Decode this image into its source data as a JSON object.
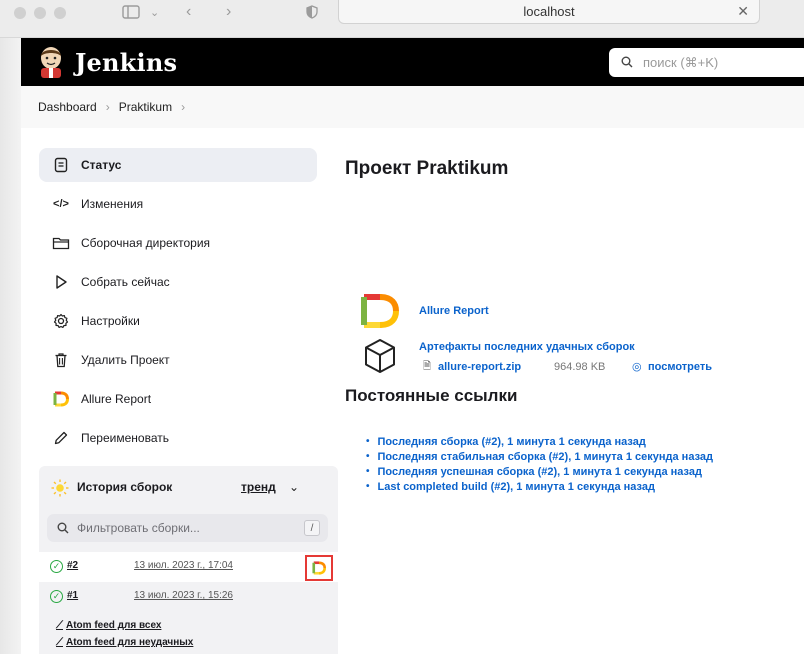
{
  "browser": {
    "url": "localhost"
  },
  "header": {
    "logo_text": "Jenkins",
    "search_placeholder": "поиск (⌘+K)"
  },
  "breadcrumb": [
    "Dashboard",
    "Praktikum"
  ],
  "sidebar": {
    "items": [
      {
        "label": "Статус",
        "icon": "status-icon"
      },
      {
        "label": "Изменения",
        "icon": "code-icon"
      },
      {
        "label": "Сборочная директория",
        "icon": "folder-icon"
      },
      {
        "label": "Собрать сейчас",
        "icon": "play-icon"
      },
      {
        "label": "Настройки",
        "icon": "gear-icon"
      },
      {
        "label": "Удалить Проект",
        "icon": "trash-icon"
      },
      {
        "label": "Allure Report",
        "icon": "allure-icon"
      },
      {
        "label": "Переименовать",
        "icon": "pencil-icon"
      }
    ]
  },
  "history": {
    "title": "История сборок",
    "trend_label": "тренд",
    "filter_placeholder": "Фильтровать сборки...",
    "filter_shortcut": "/",
    "builds": [
      {
        "number": "#2",
        "date": "13 июл. 2023 г., 17:04",
        "status": "success",
        "has_allure": true
      },
      {
        "number": "#1",
        "date": "13 июл. 2023 г., 15:26",
        "status": "success",
        "has_allure": false
      }
    ],
    "feeds": [
      "Atom feed для всех",
      "Atom feed для неудачных"
    ]
  },
  "main": {
    "title": "Проект Praktikum",
    "allure_link": "Allure Report",
    "artifacts": {
      "title": "Артефакты последних удачных сборок",
      "file_name": "allure-report.zip",
      "file_size": "964.98 KB",
      "view_label": "посмотреть"
    },
    "permalinks_title": "Постоянные ссылки",
    "permalinks": [
      "Последняя сборка (#2), 1 минута 1 секунда назад",
      "Последняя стабильная сборка (#2), 1 минута 1 секунда назад",
      "Последняя успешная сборка (#2), 1 минута 1 секунда назад",
      "Last completed build (#2), 1 минута 1 секунда назад"
    ]
  },
  "colors": {
    "link": "#0b63cc",
    "header_bg": "#000000",
    "success": "#2aa844",
    "highlight": "#e53935"
  }
}
